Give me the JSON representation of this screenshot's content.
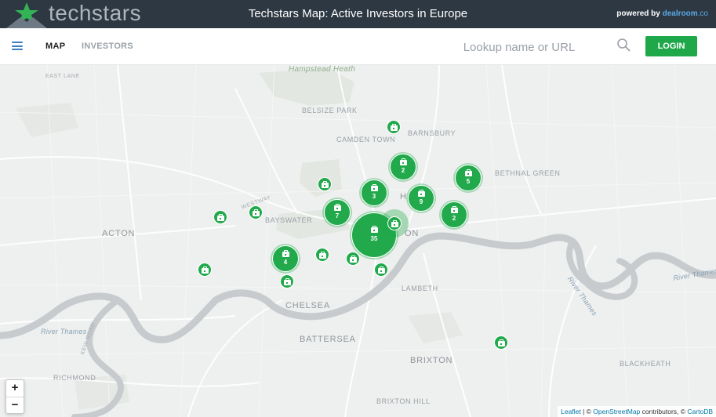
{
  "header": {
    "brand_name": "techstars",
    "title": "Techstars Map: Active Investors in Europe",
    "powered_prefix": "powered by",
    "powered_brand": "dealroom",
    "powered_tld": ".co"
  },
  "nav": {
    "tabs": [
      {
        "label": "MAP",
        "active": true
      },
      {
        "label": "INVESTORS",
        "active": false
      }
    ],
    "search_placeholder": "Lookup name or URL",
    "login_label": "LOGIN"
  },
  "map": {
    "places": [
      {
        "name": "Hampstead Heath",
        "kind": "park"
      },
      {
        "name": "EAST LANE",
        "kind": "road"
      },
      {
        "name": "BELSIZE PARK",
        "kind": "district"
      },
      {
        "name": "BARNSBURY",
        "kind": "district"
      },
      {
        "name": "CAMDEN TOWN",
        "kind": "district"
      },
      {
        "name": "BETHNAL GREEN",
        "kind": "district"
      },
      {
        "name": "ACTON",
        "kind": "area"
      },
      {
        "name": "BAYSWATER",
        "kind": "district"
      },
      {
        "name": "ON",
        "kind": "area"
      },
      {
        "name": "LAMBETH",
        "kind": "district"
      },
      {
        "name": "CHELSEA",
        "kind": "area"
      },
      {
        "name": "BATTERSEA",
        "kind": "area"
      },
      {
        "name": "River Thames",
        "kind": "river"
      },
      {
        "name": "River Thames",
        "kind": "river"
      },
      {
        "name": "River Thames",
        "kind": "river"
      },
      {
        "name": "KEW ROAD",
        "kind": "road"
      },
      {
        "name": "RICHMOND",
        "kind": "district"
      },
      {
        "name": "BRIXTON",
        "kind": "area"
      },
      {
        "name": "BLACKHEATH",
        "kind": "district"
      },
      {
        "name": "BRIXTON HILL",
        "kind": "district"
      },
      {
        "name": "WESTWAY",
        "kind": "road"
      },
      {
        "name": "H",
        "kind": "area"
      }
    ],
    "clusters": [
      {
        "count": "",
        "icon": "briefcase-icon"
      },
      {
        "count": "2",
        "icon": "briefcase-icon"
      },
      {
        "count": "5",
        "icon": "briefcase-icon"
      },
      {
        "count": "",
        "icon": "briefcase-icon"
      },
      {
        "count": "3",
        "icon": "briefcase-icon"
      },
      {
        "count": "9",
        "icon": "briefcase-icon"
      },
      {
        "count": "",
        "icon": "briefcase-icon"
      },
      {
        "count": "",
        "icon": "briefcase-icon"
      },
      {
        "count": "7",
        "icon": "briefcase-icon"
      },
      {
        "count": "2",
        "icon": "briefcase-icon"
      },
      {
        "count": "35",
        "icon": "briefcase-icon"
      },
      {
        "count": "",
        "icon": "briefcase-icon"
      },
      {
        "count": "4",
        "icon": "briefcase-icon"
      },
      {
        "count": "",
        "icon": "briefcase-icon"
      },
      {
        "count": "",
        "icon": "briefcase-icon"
      },
      {
        "count": "",
        "icon": "briefcase-icon"
      },
      {
        "count": "",
        "icon": "briefcase-icon"
      },
      {
        "count": "",
        "icon": "briefcase-icon"
      },
      {
        "count": "",
        "icon": "briefcase-icon"
      }
    ],
    "zoom_in": "+",
    "zoom_out": "−",
    "attribution": {
      "leaflet": "Leaflet",
      "sep1": " | © ",
      "osm": "OpenStreetMap",
      "mid": " contributors, © ",
      "carto": "CartoDB"
    }
  },
  "colors": {
    "topbar": "#2d3842",
    "accent_green": "#1ea84a",
    "river": "#c7cbce",
    "map_background": "#eef0ef"
  }
}
